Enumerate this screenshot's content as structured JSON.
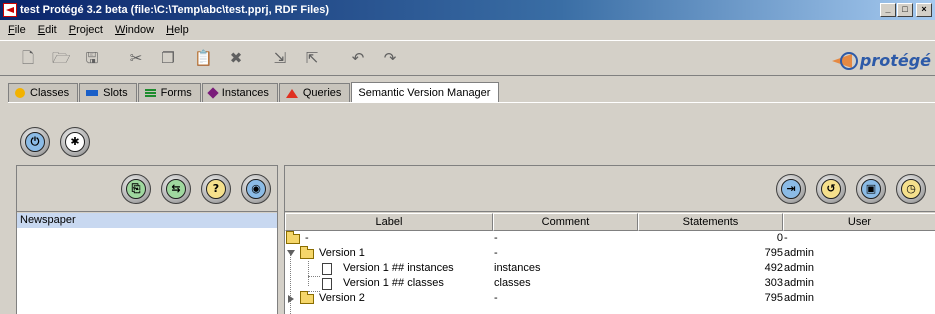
{
  "window": {
    "title": "test  Protégé 3.2 beta   (file:\\C:\\Temp\\abc\\test.pprj, RDF Files)",
    "controls": [
      "_",
      "□",
      "×"
    ]
  },
  "menu": [
    "File",
    "Edit",
    "Project",
    "Window",
    "Help"
  ],
  "toolbar": {
    "icons": [
      "new-file-icon",
      "open-file-icon",
      "save-icon",
      "cut-icon",
      "copy-icon",
      "paste-icon",
      "delete-icon",
      "insert-icon",
      "export-icon",
      "undo-icon",
      "redo-icon"
    ],
    "logo_text": "protégé"
  },
  "tabs": [
    {
      "label": "Classes",
      "icon": "classes-icon"
    },
    {
      "label": "Slots",
      "icon": "slots-icon"
    },
    {
      "label": "Forms",
      "icon": "forms-icon"
    },
    {
      "label": "Instances",
      "icon": "instances-icon"
    },
    {
      "label": "Queries",
      "icon": "queries-icon"
    },
    {
      "label": "Semantic Version Manager",
      "icon": null,
      "active": true
    }
  ],
  "left_panel": {
    "items": [
      "Newspaper"
    ]
  },
  "table": {
    "headers": [
      "Label",
      "Comment",
      "Statements",
      "User"
    ],
    "rows": [
      {
        "label": "-",
        "comment": "-",
        "statements": "0",
        "user": "-",
        "level": 0,
        "type": "folder-open",
        "toggle": ""
      },
      {
        "label": "Version 1",
        "comment": "-",
        "statements": "795",
        "user": "admin",
        "level": 0,
        "type": "folder-open",
        "toggle": "down"
      },
      {
        "label": "Version 1 ## instances",
        "comment": "instances",
        "statements": "492",
        "user": "admin",
        "level": 1,
        "type": "doc",
        "toggle": ""
      },
      {
        "label": "Version 1 ## classes",
        "comment": "classes",
        "statements": "303",
        "user": "admin",
        "level": 1,
        "type": "doc",
        "toggle": ""
      },
      {
        "label": "Version 2",
        "comment": "-",
        "statements": "795",
        "user": "admin",
        "level": 0,
        "type": "folder",
        "toggle": "right"
      }
    ]
  }
}
